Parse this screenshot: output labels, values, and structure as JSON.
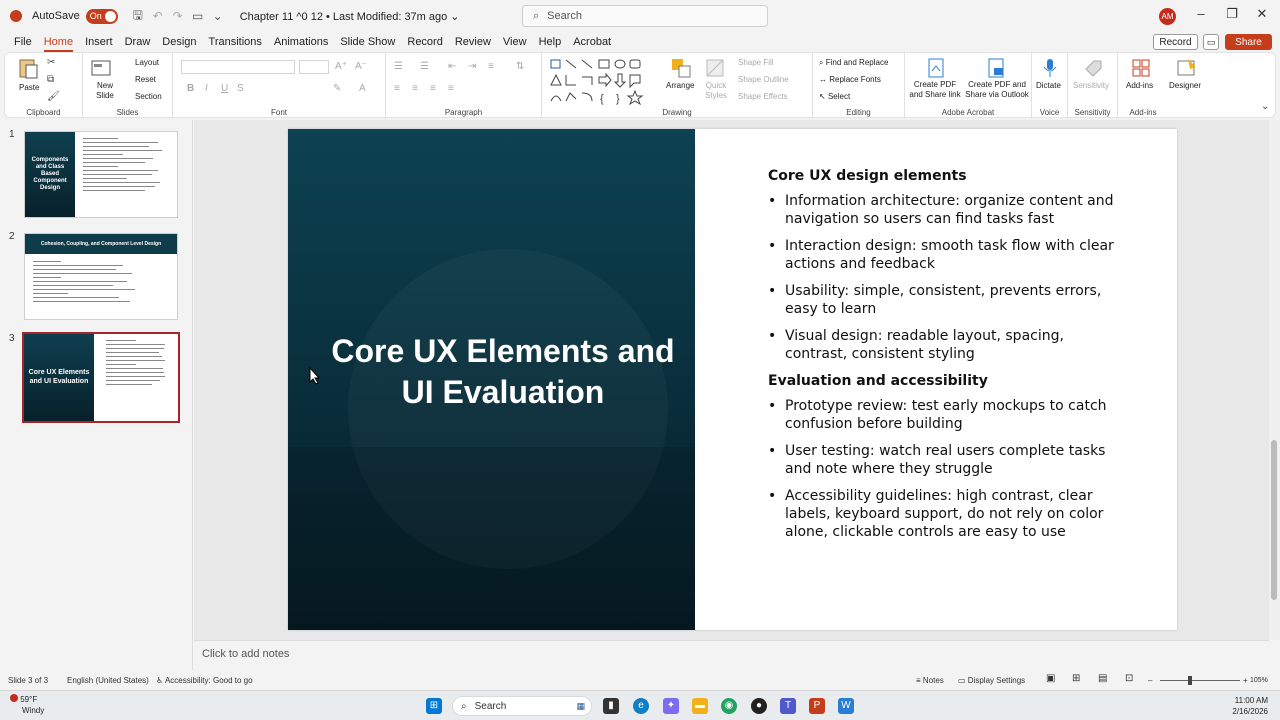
{
  "titlebar": {
    "autosave_label": "AutoSave",
    "autosave_state": "On",
    "doc_title": "Chapter 11 ^0 12 • Last Modified: 37m ago ⌄",
    "search_placeholder": "Search",
    "avatar_initials": "AM"
  },
  "menu": {
    "tabs": [
      "File",
      "Home",
      "Insert",
      "Draw",
      "Design",
      "Transitions",
      "Animations",
      "Slide Show",
      "Record",
      "Review",
      "View",
      "Help",
      "Acrobat"
    ],
    "active_tab": "Home",
    "record_label": "Record",
    "share_label": "Share"
  },
  "ribbon": {
    "clipboard": {
      "label": "Clipboard",
      "paste": "Paste"
    },
    "slides": {
      "label": "Slides",
      "new_slide": "New Slide",
      "layout": "Layout",
      "reset": "Reset",
      "section": "Section"
    },
    "font": {
      "label": "Font"
    },
    "paragraph": {
      "label": "Paragraph"
    },
    "drawing": {
      "label": "Drawing",
      "arrange": "Arrange",
      "quick_styles": "Quick Styles",
      "shape_fill": "Shape Fill",
      "shape_outline": "Shape Outline",
      "shape_effects": "Shape Effects"
    },
    "editing": {
      "label": "Editing",
      "find_replace": "Find and Replace",
      "replace_fonts": "Replace Fonts",
      "select": "Select"
    },
    "acrobat": {
      "label": "Adobe Acrobat",
      "create_pdf_share_link": "Create PDF and Share link",
      "create_pdf_outlook": "Create PDF and Share via Outlook"
    },
    "voice": {
      "label": "Voice",
      "dictate": "Dictate"
    },
    "sensitivity": {
      "label": "Sensitivity",
      "sensitivity": "Sensitivity"
    },
    "addins": {
      "label": "Add-ins",
      "addins": "Add-ins",
      "designer": "Designer"
    }
  },
  "thumbnails": [
    {
      "number": "1",
      "title": "Components and Class Based Component Design"
    },
    {
      "number": "2",
      "title": "Cohesion, Coupling, and Component Level Design"
    },
    {
      "number": "3",
      "title": "Core UX Elements and UI Evaluation"
    }
  ],
  "slide": {
    "title": "Core UX Elements and UI Evaluation",
    "sections": [
      {
        "heading": "Core UX design elements",
        "bullets": [
          "Information architecture: organize content and navigation so users can find tasks fast",
          "Interaction design: smooth task flow with clear actions and feedback",
          "Usability: simple, consistent, prevents errors, easy to learn",
          "Visual design: readable layout, spacing, contrast, consistent styling"
        ]
      },
      {
        "heading": "Evaluation and accessibility",
        "bullets": [
          "Prototype review: test early mockups to catch confusion before building",
          "User testing: watch real users complete tasks and note where they struggle",
          "Accessibility guidelines: high contrast, clear labels, keyboard support, do not rely on color alone, clickable controls are easy to use"
        ]
      }
    ]
  },
  "notes_placeholder": "Click to add notes",
  "status": {
    "slide_count": "Slide 3 of 3",
    "language": "English (United States)",
    "accessibility": "Accessibility: Good to go",
    "notes": "Notes",
    "display_settings": "Display Settings",
    "zoom": "105%"
  },
  "taskbar": {
    "weather_temp": "59°F",
    "weather_desc": "Windy",
    "search_label": "Search",
    "time": "11:00 AM",
    "date": "2/16/2026"
  },
  "colors": {
    "accent": "#c43e1c",
    "slide_dark": "#0d4252",
    "thumb_selected": "#a4262c"
  }
}
